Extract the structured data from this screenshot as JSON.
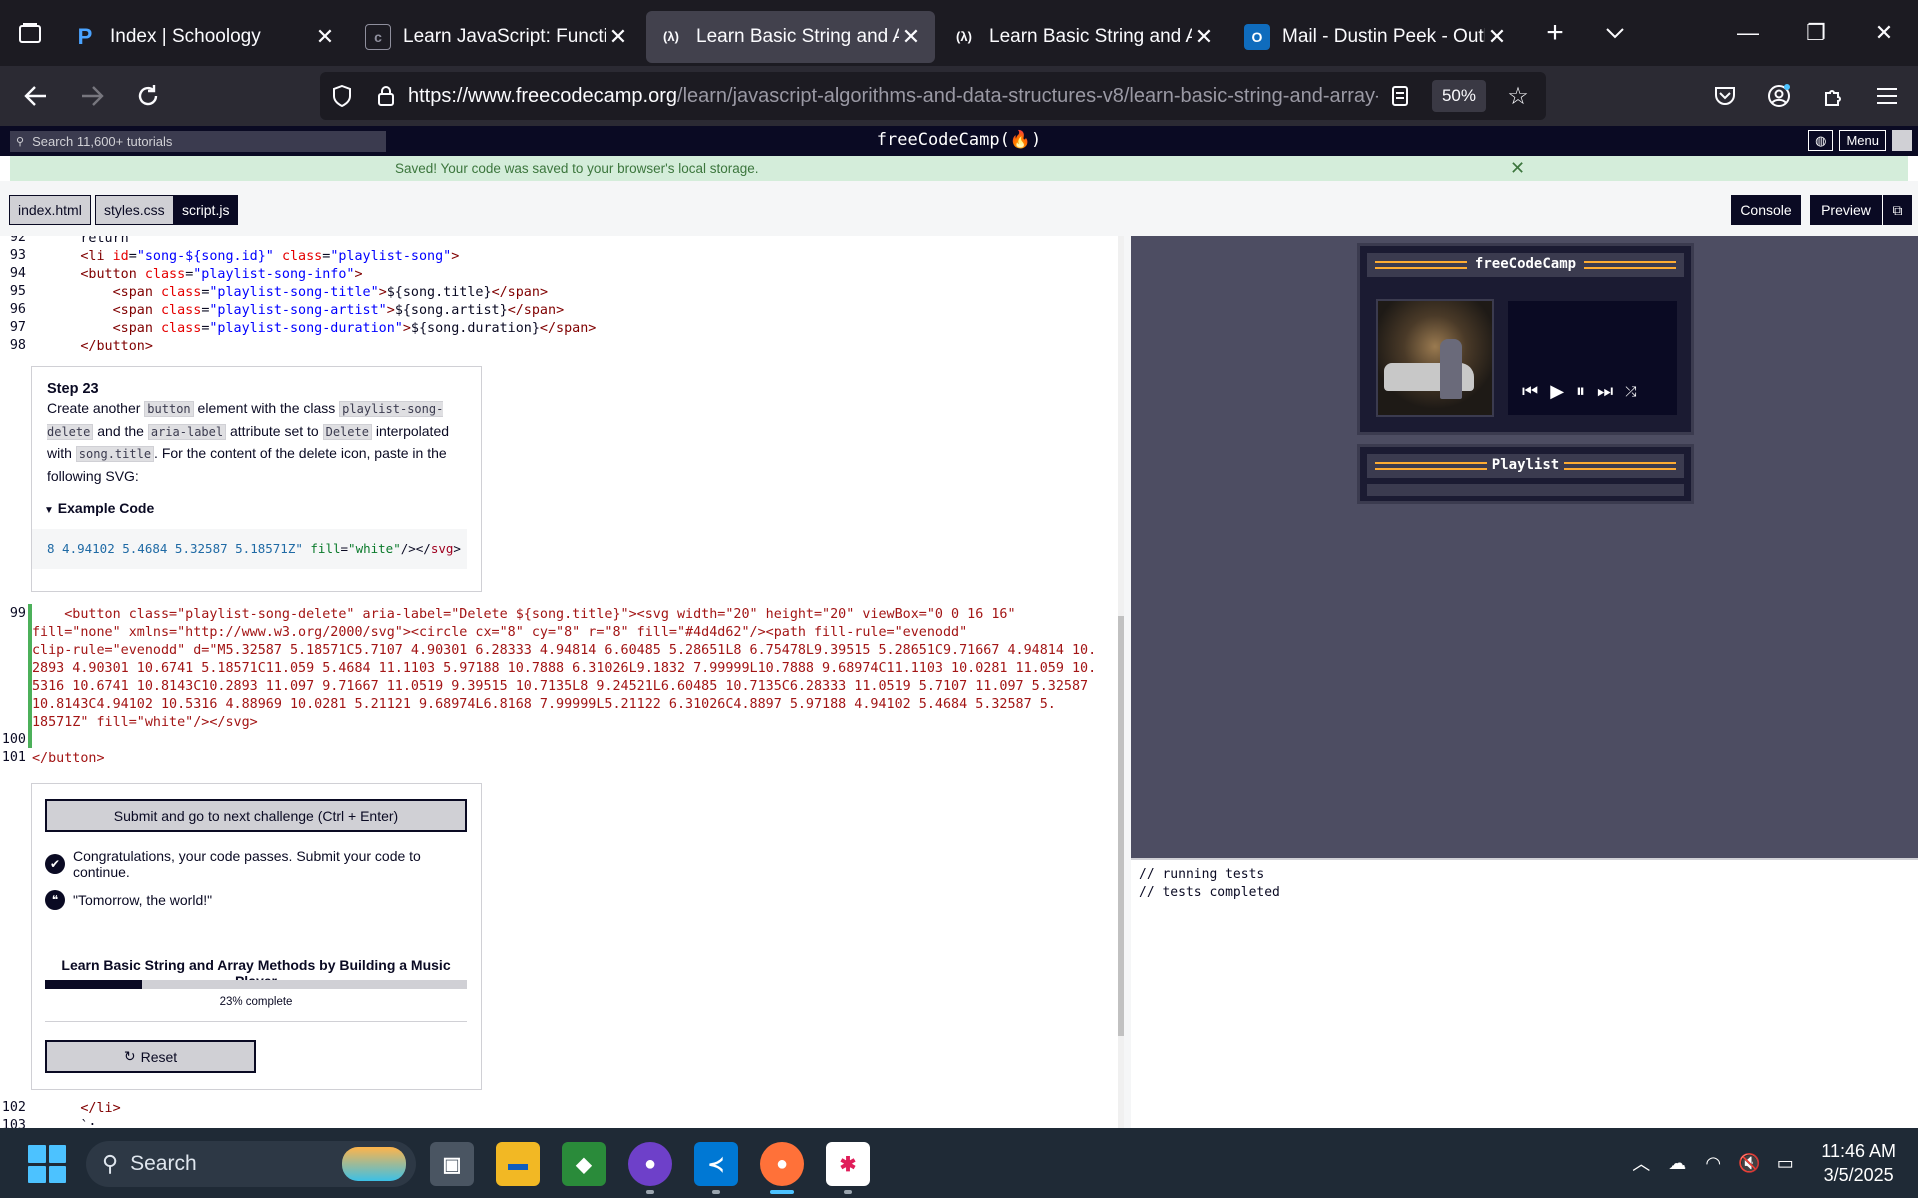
{
  "browser": {
    "tabs": [
      {
        "title": "Index | Schoology",
        "favicon": "P"
      },
      {
        "title": "Learn JavaScript: Functions",
        "favicon": "c"
      },
      {
        "title": "Learn Basic String and Array",
        "favicon": "(λ)",
        "active": true
      },
      {
        "title": "Learn Basic String and Array",
        "favicon": "(λ)"
      },
      {
        "title": "Mail - Dustin Peek - Outlook",
        "favicon": "O"
      }
    ],
    "url_host": "https://www.freecodecamp.org",
    "url_path": "/learn/javascript-algorithms-and-data-structures-v8/learn-basic-string-and-array-methods-by-building-a-music-player",
    "zoom": "50%"
  },
  "fcc": {
    "search_placeholder": "Search 11,600+ tutorials",
    "logo": "freeCodeCamp(🔥)",
    "menu_label": "Menu",
    "flash": "Saved! Your code was saved to your browser's local storage.",
    "file_tabs": [
      "index.html",
      "styles.css",
      "script.js"
    ],
    "console_btn": "Console",
    "preview_btn": "Preview"
  },
  "editor": {
    "top_lines": [
      {
        "n": "92",
        "text": "      return"
      },
      {
        "n": "93",
        "text": "      <li id=\"song-${song.id}\" class=\"playlist-song\">"
      },
      {
        "n": "94",
        "text": "      <button class=\"playlist-song-info\">"
      },
      {
        "n": "95",
        "text": "          <span class=\"playlist-song-title\">${song.title}</span>"
      },
      {
        "n": "96",
        "text": "          <span class=\"playlist-song-artist\">${song.artist}</span>"
      },
      {
        "n": "97",
        "text": "          <span class=\"playlist-song-duration\">${song.duration}</span>"
      },
      {
        "n": "98",
        "text": "      </button>"
      }
    ],
    "edit_lines": [
      {
        "n": "99",
        "text": "    <button class=\"playlist-song-delete\" aria-label=\"Delete ${song.title}\"><svg width=\"20\" height=\"20\" viewBox=\"0 0 16 16\""
      },
      {
        "n": "",
        "text": "fill=\"none\" xmlns=\"http://www.w3.org/2000/svg\"><circle cx=\"8\" cy=\"8\" r=\"8\" fill=\"#4d4d62\"/><path fill-rule=\"evenodd\""
      },
      {
        "n": "",
        "text": "clip-rule=\"evenodd\" d=\"M5.32587 5.18571C5.7107 4.90301 6.28333 4.94814 6.60485 5.28651L8 6.75478L9.39515 5.28651C9.71667 4.94814 10."
      },
      {
        "n": "",
        "text": "2893 4.90301 10.6741 5.18571C11.059 5.4684 11.1103 5.97188 10.7888 6.31026L9.1832 7.99999L10.7888 9.68974C11.1103 10.0281 11.059 10."
      },
      {
        "n": "",
        "text": "5316 10.6741 10.8143C10.2893 11.097 9.71667 11.0519 9.39515 10.7135L8 9.24521L6.60485 10.7135C6.28333 11.0519 5.7107 11.097 5.32587"
      },
      {
        "n": "",
        "text": "10.8143C4.94102 10.5316 4.88969 10.0281 5.21121 9.68974L6.8168 7.99999L5.21122 6.31026C4.8897 5.97188 4.94102 5.4684 5.32587 5."
      },
      {
        "n": "",
        "text": "18571Z\" fill=\"white\"/></svg>"
      },
      {
        "n": "100",
        "text": ""
      },
      {
        "n": "101",
        "text": "</button>"
      }
    ],
    "bottom_lines": [
      {
        "n": "102",
        "text": "      </li>"
      },
      {
        "n": "103",
        "text": "      `;"
      }
    ]
  },
  "step": {
    "title": "Step 23",
    "p1": "Create another ",
    "c1": "button",
    "p2": " element with the class ",
    "c2": "playlist-song-delete",
    "p3": " and the ",
    "c3": "aria-label",
    "p4": " attribute set to ",
    "c4": "Delete",
    "p5": " interpolated with ",
    "c5": "song.title",
    "p6": ". For the content of the delete icon, paste in the following SVG:",
    "example_label": "Example Code",
    "example_nums": "8 4.94102 5.4684 5.32587 5.18571Z\" ",
    "example_attr": "fill",
    "example_eq": "=",
    "example_val": "\"white\"",
    "example_close": "/></",
    "example_tag": "svg",
    "example_end": ">"
  },
  "lower_panel": {
    "submit": "Submit and go to next challenge (Ctrl + Enter)",
    "passed": "Congratulations, your code passes. Submit your code to continue.",
    "quote": "\"Tomorrow, the world!\"",
    "block_title": "Learn Basic String and Array Methods by Building a Music Player",
    "progress": 0.23,
    "progress_text": "23% complete",
    "reset": "Reset"
  },
  "preview": {
    "player_title": "freeCodeCamp",
    "playlist_title": "Playlist"
  },
  "console": {
    "lines": [
      "// running tests",
      "// tests completed"
    ]
  },
  "taskbar": {
    "search_label": "Search",
    "time": "11:46 AM",
    "date": "3/5/2025"
  }
}
